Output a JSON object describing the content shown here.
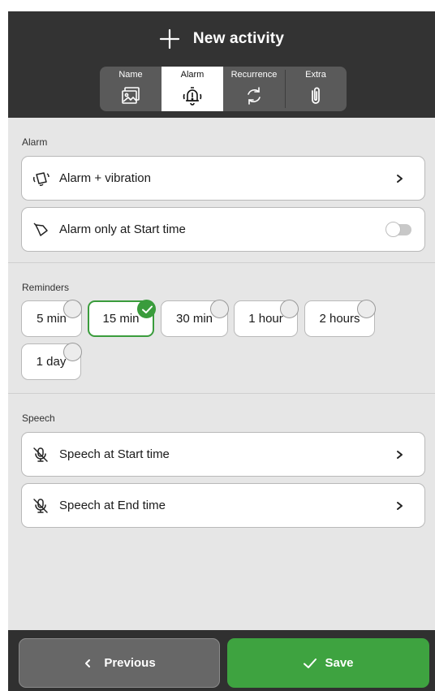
{
  "header": {
    "title": "New activity",
    "title_icon": "plus-icon",
    "tabs": [
      {
        "label": "Name",
        "icon": "image-icon",
        "active": false
      },
      {
        "label": "Alarm",
        "icon": "alarm-bell-icon",
        "active": true
      },
      {
        "label": "Recurrence",
        "icon": "repeat-icon",
        "active": false
      },
      {
        "label": "Extra",
        "icon": "paperclip-icon",
        "active": false
      }
    ]
  },
  "alarm": {
    "section_label": "Alarm",
    "type_row": {
      "label": "Alarm + vibration",
      "icon": "vibrate-icon"
    },
    "start_only_row": {
      "label": "Alarm only at Start time",
      "icon": "bell-icon",
      "toggle_on": false
    }
  },
  "reminders": {
    "section_label": "Reminders",
    "options": [
      {
        "label": "5 min",
        "selected": false
      },
      {
        "label": "15 min",
        "selected": true
      },
      {
        "label": "30 min",
        "selected": false
      },
      {
        "label": "1 hour",
        "selected": false
      },
      {
        "label": "2 hours",
        "selected": false
      },
      {
        "label": "1 day",
        "selected": false
      }
    ]
  },
  "speech": {
    "section_label": "Speech",
    "start_row": {
      "label": "Speech at Start time",
      "icon": "mic-off-icon"
    },
    "end_row": {
      "label": "Speech at End time",
      "icon": "mic-off-icon"
    }
  },
  "footer": {
    "previous_label": "Previous",
    "save_label": "Save"
  },
  "colors": {
    "accent_green": "#3ea340",
    "header_bg": "#333333",
    "content_bg": "#e6e6e6"
  }
}
